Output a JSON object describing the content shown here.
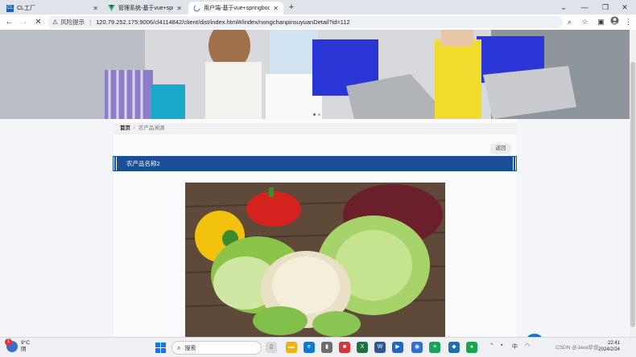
{
  "browser": {
    "tabs": [
      {
        "label": "CL工厂",
        "favicon": "CL",
        "favicon_color": "#1f5fb8",
        "active": false
      },
      {
        "label": "管理系统-基于vue+springbo",
        "favicon": "vue-logo-icon",
        "favicon_color": "#42b883",
        "active": false
      },
      {
        "label": "用户端-基于vue+springboo",
        "favicon": "loading-icon",
        "favicon_color": "#4a7bd0",
        "active": true
      }
    ],
    "new_tab_glyph": "+",
    "risk_label": "风险提示",
    "url": "120.79.252.175:9006/cl4114842/client/dist/index.html#/index/nongchanpinsuyuanDetail?id=112"
  },
  "page": {
    "breadcrumb": {
      "home": "首页",
      "separator": "/",
      "current": "农产品溯源"
    },
    "back_label": "返回",
    "product_title": "农产品名称2",
    "banner_active_dot": 0,
    "colors": {
      "title_bar": "#1a4e96",
      "accent": "#2e6fcf"
    }
  },
  "taskbar": {
    "weather_temp": "9°C",
    "weather_desc": "阴",
    "weather_badge": "1",
    "search_placeholder": "搜索",
    "time": "22:41",
    "date": "2024/2/24",
    "ime": "中",
    "watermark": "CSDN @Java毕设"
  }
}
